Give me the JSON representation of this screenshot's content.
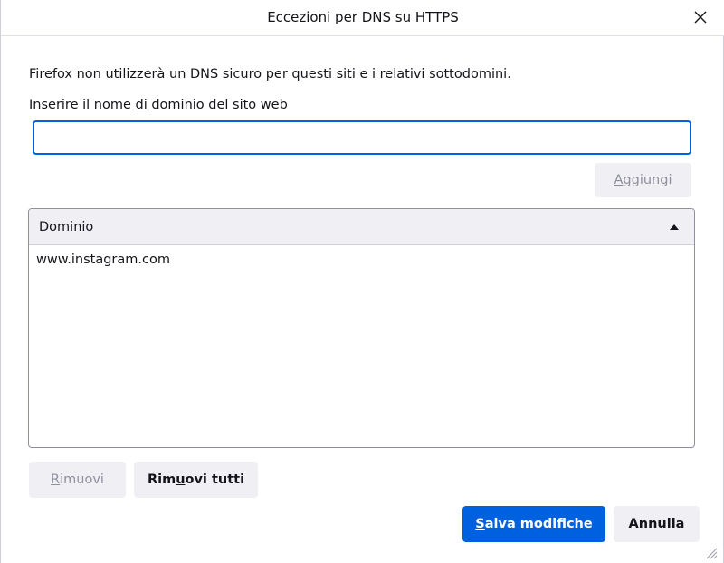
{
  "dialog": {
    "title": "Eccezioni per DNS su HTTPS",
    "description": "Firefox non utilizzerà un DNS sicuro per questi siti e i relativi sottodomini.",
    "field_label_before": "Inserire il nome ",
    "field_label_accesskey": "di",
    "field_label_after": " dominio del sito web",
    "domain_input": {
      "value": "",
      "placeholder": ""
    },
    "add_button": {
      "accesskey": "A",
      "rest": "ggiungi",
      "enabled": false
    },
    "table": {
      "column_header": "Dominio",
      "sort": "ascending",
      "rows": [
        "www.instagram.com"
      ]
    },
    "remove_button": {
      "accesskey": "R",
      "rest": "imuovi",
      "enabled": false
    },
    "remove_all_button": {
      "before": "Rim",
      "accesskey": "u",
      "after": "ovi tutti"
    },
    "save_button": {
      "accesskey": "S",
      "rest": "alva modifiche"
    },
    "cancel_button": {
      "label": "Annulla"
    }
  },
  "colors": {
    "accent": "#0061e0",
    "button_bg": "#f0f0f4",
    "disabled_text": "#8f8f9d"
  },
  "icons": {
    "close": "close-icon",
    "sort": "sort-ascending-icon",
    "resize": "resize-grip-icon"
  }
}
